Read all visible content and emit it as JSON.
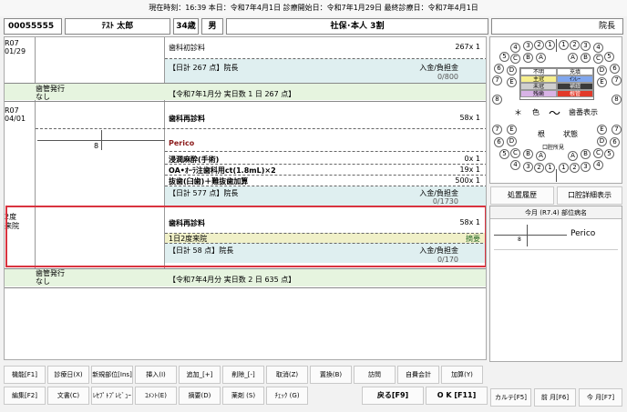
{
  "titlebar": {
    "text": "現在時刻：16:39  本日：令和7年4月1日   診療開始日：令和7年1月29日   最終診療日：令和7年4月1日"
  },
  "patient": {
    "id": "00055555",
    "name": "ﾃｽﾄ 太郎",
    "age": "34歳",
    "sex": "男",
    "insurance": "社保･本人 3割",
    "doctor": "院長"
  },
  "entries": {
    "e1": {
      "date": "R07\n01/29",
      "item": "歯科初診料",
      "qty": "267x 1",
      "daytotal": "【日計 267 点】院長",
      "payhdr": "入金/負担金",
      "payval": "0/800"
    },
    "rx1": {
      "label": "歯管発行\nなし",
      "summary": "【令和7年1月分 実日数 1 日  267 点】"
    },
    "e2": {
      "date": "R07\n04/01",
      "item": "歯科再診料",
      "qty": "58x 1",
      "tooth": "8",
      "perico": "Perico",
      "p1": "浸潤麻酔(手術)",
      "q1": "0x 1",
      "p2": "OA•ｵｰﾗ注歯科用ct(1.8mL)×2",
      "q2": "19x 1",
      "p3": "抜歯(臼歯)＋難抜歯加算",
      "q3": "500x 1",
      "daytotal": "【日計 577 点】院長",
      "payhdr": "入金/負担金",
      "payval": "0/1730"
    },
    "e3": {
      "label": "2度\n来院",
      "item": "歯科再診料",
      "qty": "58x 1",
      "note": "1日2度来院",
      "tag": "摘要",
      "daytotal": "【日計 58 点】院長",
      "payhdr": "入金/負担金",
      "payval": "0/170"
    },
    "rx2": {
      "label": "歯管発行\nなし",
      "summary": "【令和7年4月分 実日数 2 日  635 点】"
    }
  },
  "teeth": {
    "upperL": [
      "4",
      "3",
      "2",
      "1"
    ],
    "upperR": [
      "1",
      "2",
      "3",
      "4"
    ],
    "upperSideL": [
      "5",
      "6",
      "7"
    ],
    "upperSideR": [
      "5",
      "6",
      "7"
    ],
    "upperLetL": [
      "C",
      "D",
      "E"
    ],
    "upperLetR": [
      "C",
      "D",
      "E"
    ],
    "midL": "8",
    "midR": "8",
    "lowerSideL": [
      "7",
      "6",
      "5"
    ],
    "lowerSideR": [
      "7",
      "6",
      "5"
    ],
    "lowerLetL": [
      "E",
      "D",
      "C"
    ],
    "lowerLetR": [
      "E",
      "D",
      "C"
    ],
    "lowerL": [
      "4",
      "3",
      "2",
      "1"
    ],
    "lowerR": [
      "1",
      "2",
      "3",
      "4"
    ],
    "innerUpL": [
      "B",
      "A"
    ],
    "innerUpR": [
      "A",
      "B"
    ],
    "innerLoL": [
      "B",
      "A"
    ],
    "innerLoR": [
      "A",
      "B"
    ]
  },
  "legend": [
    {
      "t": "不明",
      "c": "#ffffff",
      "fg": "#000"
    },
    {
      "t": "充填",
      "c": "#ffffff",
      "fg": "#000"
    },
    {
      "t": "主冠",
      "c": "#f6ef8c",
      "fg": "#000"
    },
    {
      "t": "ｲﾝﾚｰ",
      "c": "#7fa6ee",
      "fg": "#000"
    },
    {
      "t": "未冠",
      "c": "#cfcfcf",
      "fg": "#000"
    },
    {
      "t": "補綴",
      "c": "#3a3a3a",
      "fg": "#fff"
    },
    {
      "t": "残歯",
      "c": "#d8b3e6",
      "fg": "#000"
    },
    {
      "t": "根管",
      "c": "#e23a2a",
      "fg": "#fff"
    }
  ],
  "dental": {
    "star": "＊",
    "color": "色",
    "tilde": "～",
    "toothview": "歯番表示",
    "root": "根",
    "state": "状態",
    "mouthfind": "口腔所見"
  },
  "rightpanel": {
    "history": "処置履歴",
    "mouthdetail": "口腔詳細表示",
    "todaylabel": "今月 (R7.4) 部位病名",
    "tooth": "8",
    "perico": "Perico"
  },
  "buttons": {
    "row1": [
      "機能[F1]",
      "診療日(X)",
      "新規部位[Ins]",
      "挿入(I)",
      "追加_[+]",
      "削除_[-]",
      "取消(Z)",
      "置換(B)",
      "訪問",
      "自費会計",
      "加算(Y)"
    ],
    "row2": [
      "編集[F2]",
      "文書(C)",
      "ﾚｾﾌﾟﾄﾌﾟﾚﾋﾞｭｰ",
      "ｺﾒﾝﾄ(E)",
      "摘要(D)",
      "薬剤 (S)",
      "ﾁｪｯｸ (G)"
    ],
    "back": "戻る[F9]",
    "ok": "O K [F11]",
    "karte": "カルテ[F5]",
    "prev": "前 月[F6]",
    "next": "今 月[F7]"
  }
}
